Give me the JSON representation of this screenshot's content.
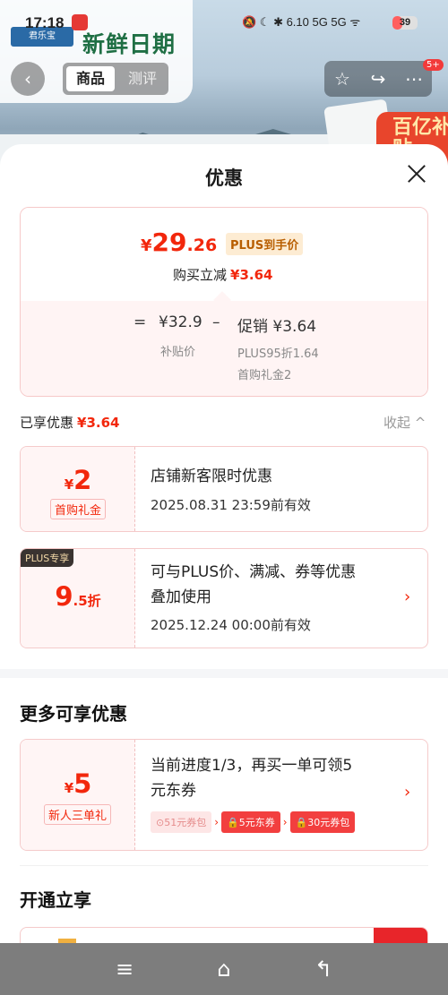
{
  "status_bar": {
    "time": "17:18",
    "indicators": "🔕 ☾ ✱ 6.10 5G 5G ᯤ",
    "battery": "39",
    "battery_level": 0.39
  },
  "product": {
    "title": "新鲜日期",
    "brand": "君乐宝",
    "label_text": "百亿补贴"
  },
  "top_nav": {
    "tab_product": "商品",
    "tab_review": "测评",
    "badge": "5+"
  },
  "sheet": {
    "title": "优惠",
    "final_price": {
      "symbol": "¥",
      "int": "29",
      "dec": ".26",
      "tag": "PLUS到手价"
    },
    "reduce": {
      "label": "购买立减",
      "value": "¥3.64"
    },
    "formula": {
      "eq": "=",
      "base": "¥32.9",
      "base_label": "补贴价",
      "minus": "–",
      "promo": "促销 ¥3.64",
      "promo_detail_1": "PLUS95折1.64",
      "promo_detail_2": "首购礼金2"
    },
    "enjoyed": {
      "label": "已享优惠",
      "value": "¥3.64",
      "collapse": "收起 ^"
    },
    "coupons": [
      {
        "symbol": "¥",
        "amount": "2",
        "suffix": "",
        "tag": "首购礼金",
        "title": "店铺新客限时优惠",
        "date": "2025.08.31 23:59前有效"
      },
      {
        "plus_tag": "PLUS专享",
        "amount": "9",
        "suffix": ".5折",
        "title_1": "可与PLUS价、满减、券等优惠",
        "title_2": "叠加使用",
        "date": "2025.12.24 00:00前有效",
        "arrow": "›"
      }
    ],
    "more": {
      "title": "更多可享优惠",
      "card": {
        "symbol": "¥",
        "amount": "5",
        "tag": "新人三单礼",
        "title_1": "当前进度1/3，再买一单可领5",
        "title_2": "元东券",
        "arrow": "›",
        "chips": [
          "⊙51元券包",
          "🔒5元东券",
          "🔒30元券包"
        ]
      }
    },
    "open": {
      "title": "开通立享"
    }
  },
  "nav_bar": {
    "menu": "≡",
    "home": "⌂",
    "back": "↰"
  }
}
